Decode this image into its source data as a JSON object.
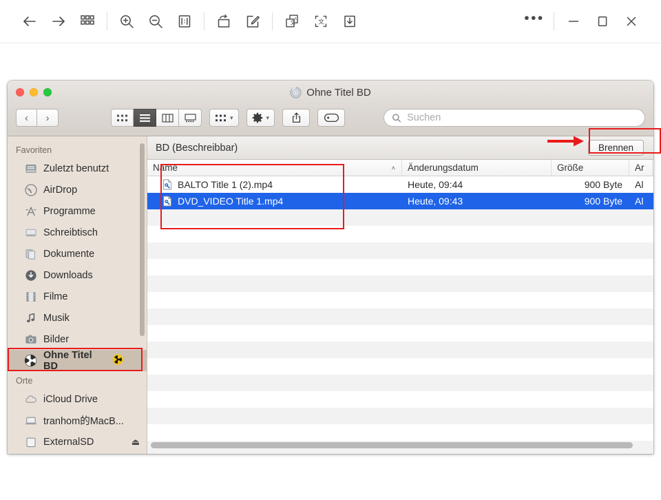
{
  "app_toolbar": {
    "buttons": [
      {
        "name": "back-button",
        "icon": "arrow-left-icon"
      },
      {
        "name": "forward-button",
        "icon": "arrow-right-icon"
      },
      {
        "name": "thumbnails-button",
        "icon": "grid-icon"
      },
      {
        "name": "zoom-in-button",
        "icon": "magnifier-plus-icon"
      },
      {
        "name": "zoom-out-button",
        "icon": "magnifier-minus-icon"
      },
      {
        "name": "fit-width-button",
        "icon": "fit-page-icon"
      },
      {
        "name": "rotate-button",
        "icon": "rotate-rectangle-icon"
      },
      {
        "name": "annotate-button",
        "icon": "pencil-square-icon"
      },
      {
        "name": "translate-copy-button",
        "icon": "translate-pages-icon"
      },
      {
        "name": "ocr-select-button",
        "icon": "ocr-brackets-icon"
      },
      {
        "name": "download-button",
        "icon": "download-tray-icon"
      }
    ],
    "more_label": "•••",
    "window_controls": {
      "minimize": "minimize-icon",
      "maximize": "maximize-icon",
      "close": "close-icon"
    }
  },
  "finder": {
    "window_title": "Ohne Titel BD",
    "traffic_lights": {
      "close": "#ff5f57",
      "minimize": "#febc2e",
      "zoom": "#28c840"
    },
    "toolbar": {
      "back": "‹",
      "forward": "›",
      "view_modes": [
        {
          "name": "icon-view-button",
          "active": false
        },
        {
          "name": "list-view-button",
          "active": true
        },
        {
          "name": "column-view-button",
          "active": false
        },
        {
          "name": "gallery-view-button",
          "active": false
        }
      ],
      "arrange_button": "arrange-icon",
      "action_button": "gear-icon",
      "share_button": "share-icon",
      "tag_button": "tag-icon",
      "search_placeholder": "Suchen",
      "search_value": ""
    },
    "sidebar": {
      "sections": [
        {
          "header": "Favoriten",
          "items": [
            {
              "label": "Zuletzt benutzt",
              "icon": "recents-icon",
              "selected": false
            },
            {
              "label": "AirDrop",
              "icon": "airdrop-icon",
              "selected": false
            },
            {
              "label": "Programme",
              "icon": "applications-icon",
              "selected": false
            },
            {
              "label": "Schreibtisch",
              "icon": "desktop-icon",
              "selected": false
            },
            {
              "label": "Dokumente",
              "icon": "documents-icon",
              "selected": false
            },
            {
              "label": "Downloads",
              "icon": "downloads-icon",
              "selected": false
            },
            {
              "label": "Filme",
              "icon": "movies-icon",
              "selected": false
            },
            {
              "label": "Musik",
              "icon": "music-icon",
              "selected": false
            },
            {
              "label": "Bilder",
              "icon": "pictures-icon",
              "selected": false
            },
            {
              "label": "Ohne Titel BD",
              "icon": "burn-disc-icon",
              "badge": "radioactive-badge-icon",
              "selected": true
            }
          ]
        },
        {
          "header": "Orte",
          "items": [
            {
              "label": "iCloud Drive",
              "icon": "cloud-icon",
              "selected": false
            },
            {
              "label": "tranhom的MacB...",
              "icon": "laptop-icon",
              "selected": false
            },
            {
              "label": "ExternalSD",
              "icon": "drive-icon",
              "badge": "eject-icon",
              "selected": false
            }
          ]
        }
      ]
    },
    "burn_bar": {
      "label": "BD (Beschreibbar)",
      "burn_button": "Brennen"
    },
    "columns": [
      {
        "label": "Name",
        "sorted": true,
        "sort_glyph": "˄"
      },
      {
        "label": "Änderungsdatum",
        "sorted": false
      },
      {
        "label": "Größe",
        "sorted": false
      },
      {
        "label": "Ar",
        "sorted": false
      }
    ],
    "files": [
      {
        "name": "BALTO Title 1 (2).mp4",
        "modified": "Heute, 09:44",
        "size": "900 Byte",
        "kind": "Al",
        "icon": "mp4-file-icon",
        "selected": false
      },
      {
        "name": "DVD_VIDEO Title 1.mp4",
        "modified": "Heute, 09:43",
        "size": "900 Byte",
        "kind": "Al",
        "icon": "mp4-file-icon",
        "selected": true
      }
    ]
  },
  "annotations": {
    "accent_color": "#e81b1b",
    "boxes": [
      {
        "name": "file-list-highlight"
      },
      {
        "name": "burn-button-highlight"
      },
      {
        "name": "sidebar-disc-highlight"
      }
    ],
    "arrows": [
      {
        "name": "burn-button-arrow"
      }
    ]
  }
}
